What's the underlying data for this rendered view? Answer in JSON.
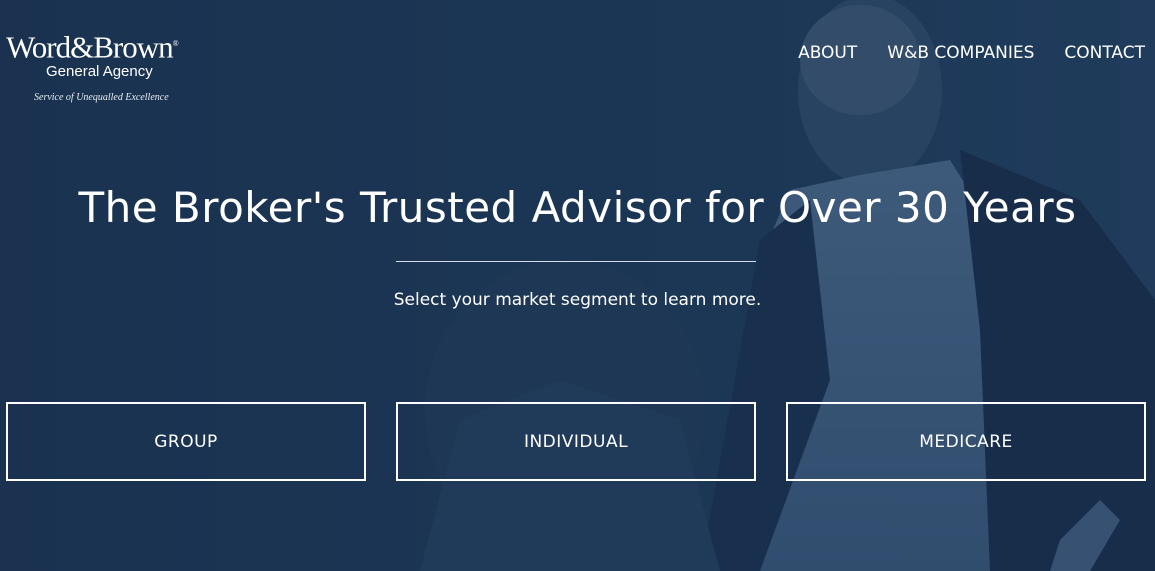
{
  "brand": {
    "wordmark": "Word&Brown",
    "registered": "®",
    "subtitle": "General Agency",
    "tagline": "Service of Unequalled Excellence"
  },
  "nav": {
    "items": [
      {
        "label": "ABOUT"
      },
      {
        "label": "W&B COMPANIES"
      },
      {
        "label": "CONTACT"
      }
    ]
  },
  "hero": {
    "headline": "The Broker's Trusted Advisor for Over 30 Years",
    "subtext": "Select your market segment to learn more."
  },
  "segments": [
    {
      "label": "GROUP"
    },
    {
      "label": "INDIVIDUAL"
    },
    {
      "label": "MEDICARE"
    }
  ],
  "colors": {
    "background": "#1f3a59",
    "overlay": "#18304d",
    "text": "#ffffff"
  }
}
